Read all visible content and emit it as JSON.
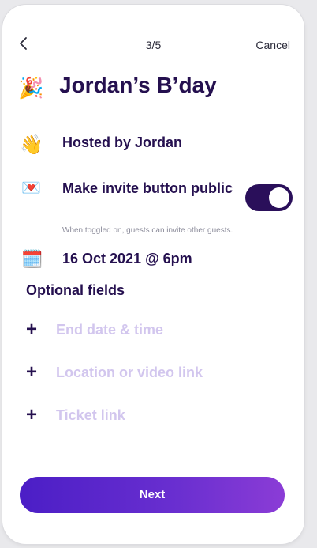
{
  "header": {
    "back_icon": "chevron-left-icon",
    "step": "3/5",
    "cancel_label": "Cancel"
  },
  "event": {
    "title_icon": "🎉",
    "title": "Jordan’s B’day"
  },
  "hosted": {
    "icon": "👋",
    "label": "Hosted by Jordan"
  },
  "invite": {
    "icon": "💌",
    "label": "Make invite button public",
    "help": "When toggled on, guests can invite other guests.",
    "toggle_on": true,
    "toggle_color": "#2a0f5a"
  },
  "date": {
    "icon": "🗓️",
    "label": "16 Oct 2021 @ 6pm"
  },
  "optional": {
    "title": "Optional fields",
    "items": [
      {
        "icon": "+",
        "label": "End date & time"
      },
      {
        "icon": "+",
        "label": "Location or video link"
      },
      {
        "icon": "+",
        "label": "Ticket link"
      }
    ]
  },
  "footer": {
    "next_label": "Next"
  },
  "colors": {
    "primary_text": "#25104f",
    "placeholder_text": "#d2c6ee",
    "button_gradient_start": "#4b1ec6",
    "button_gradient_end": "#8b3cd6"
  }
}
